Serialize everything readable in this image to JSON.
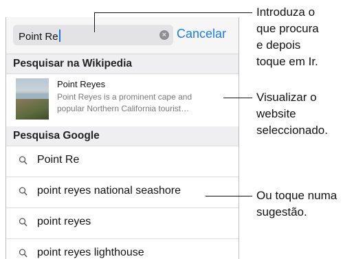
{
  "search": {
    "query": "Point Re",
    "cancel_label": "Cancelar"
  },
  "sections": {
    "wikipedia_header": "Pesquisar na Wikipedia",
    "google_header": "Pesquisa Google"
  },
  "wiki_result": {
    "title": "Point Reyes",
    "description_line1": "Point Reyes is a prominent cape and",
    "description_line2": "popular Northern California tourist…"
  },
  "suggestions": [
    "Point Re",
    "point reyes national seashore",
    "point reyes",
    "point reyes lighthouse"
  ],
  "callouts": {
    "search": [
      "Introduza o",
      "que procura",
      "e depois",
      "toque em Ir."
    ],
    "preview": [
      "Visualizar o",
      "website",
      "seleccionado."
    ],
    "suggestion": [
      "Ou toque numa",
      "sugestão."
    ]
  },
  "icons": {
    "clear": "clear-icon",
    "search": "magnifier-icon"
  },
  "colors": {
    "accent": "#1a7cf5"
  }
}
